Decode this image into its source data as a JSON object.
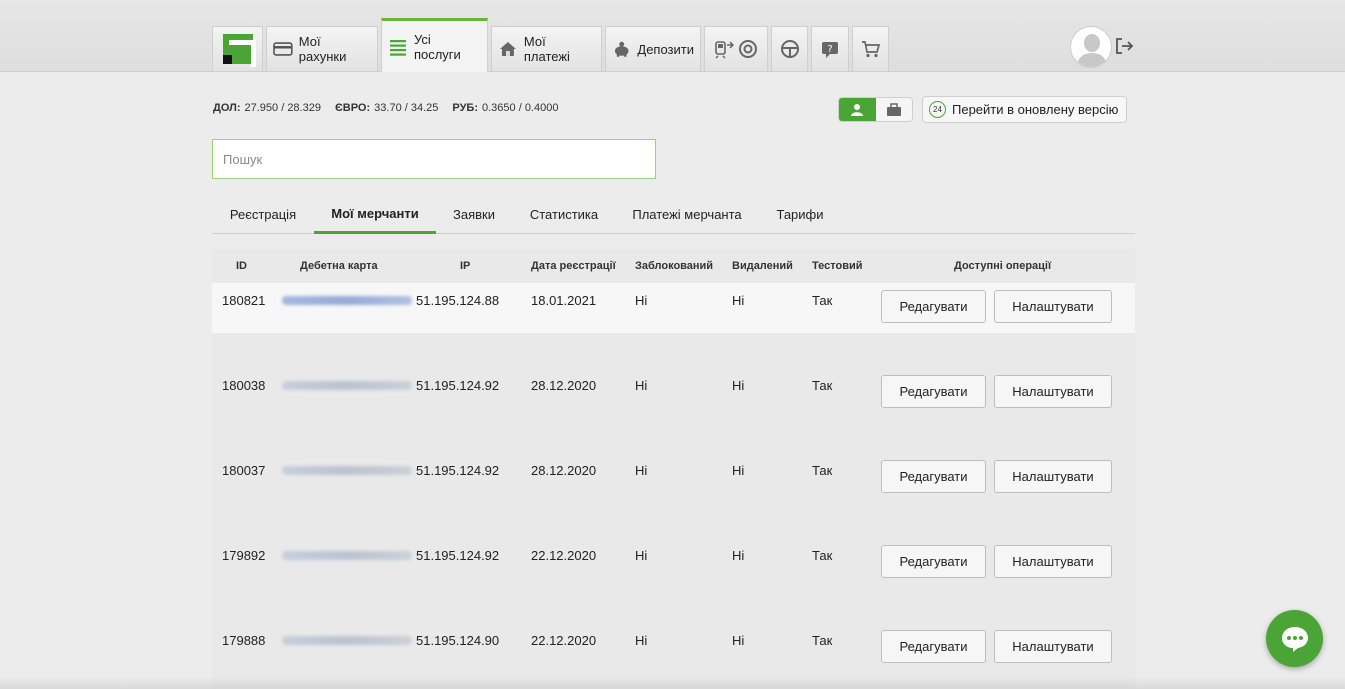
{
  "nav": {
    "tabs": [
      {
        "label": "Мої рахунки",
        "icon": "card-icon"
      },
      {
        "label": "Усі послуги",
        "icon": "list-icon"
      },
      {
        "label": "Мої платежі",
        "icon": "home-icon"
      },
      {
        "label": "Депозити",
        "icon": "piggy-bank-icon"
      }
    ],
    "icon_tabs": [
      "transport-icon",
      "lifebuoy-icon",
      "steering-wheel-icon",
      "help-icon",
      "cart-icon"
    ],
    "active_tab": "Усі послуги"
  },
  "rates": {
    "usd_label": "ДОЛ:",
    "usd_value": "27.950 / 28.329",
    "eur_label": "ЄВРО:",
    "eur_value": "33.70 / 34.25",
    "rub_label": "РУБ:",
    "rub_value": "0.3650 / 0.4000"
  },
  "new_version": {
    "badge": "24",
    "label": "Перейти в оновлену версію"
  },
  "search": {
    "placeholder": "Пошук",
    "value": ""
  },
  "subtabs": [
    "Реєстрація",
    "Мої мерчанти",
    "Заявки",
    "Статистика",
    "Платежі мерчанта",
    "Тарифи"
  ],
  "active_subtab": "Мої мерчанти",
  "table": {
    "headers": [
      "ID",
      "Дебетна карта",
      "IP",
      "Дата реєстрації",
      "Заблокований",
      "Видалений",
      "Тестовий",
      "Доступні операції"
    ],
    "rows": [
      {
        "id": "180821",
        "ip": "51.195.124.88",
        "date": "18.01.2021",
        "blocked": "Ні",
        "deleted": "Ні",
        "test": "Так"
      },
      {
        "id": "180038",
        "ip": "51.195.124.92",
        "date": "28.12.2020",
        "blocked": "Ні",
        "deleted": "Ні",
        "test": "Так"
      },
      {
        "id": "180037",
        "ip": "51.195.124.92",
        "date": "28.12.2020",
        "blocked": "Ні",
        "deleted": "Ні",
        "test": "Так"
      },
      {
        "id": "179892",
        "ip": "51.195.124.92",
        "date": "22.12.2020",
        "blocked": "Ні",
        "deleted": "Ні",
        "test": "Так"
      },
      {
        "id": "179888",
        "ip": "51.195.124.90",
        "date": "22.12.2020",
        "blocked": "Ні",
        "deleted": "Ні",
        "test": "Так"
      }
    ],
    "edit_label": "Редагувати",
    "settings_label": "Налаштувати"
  },
  "colors": {
    "accent": "#4aa536",
    "background": "#ececec"
  }
}
